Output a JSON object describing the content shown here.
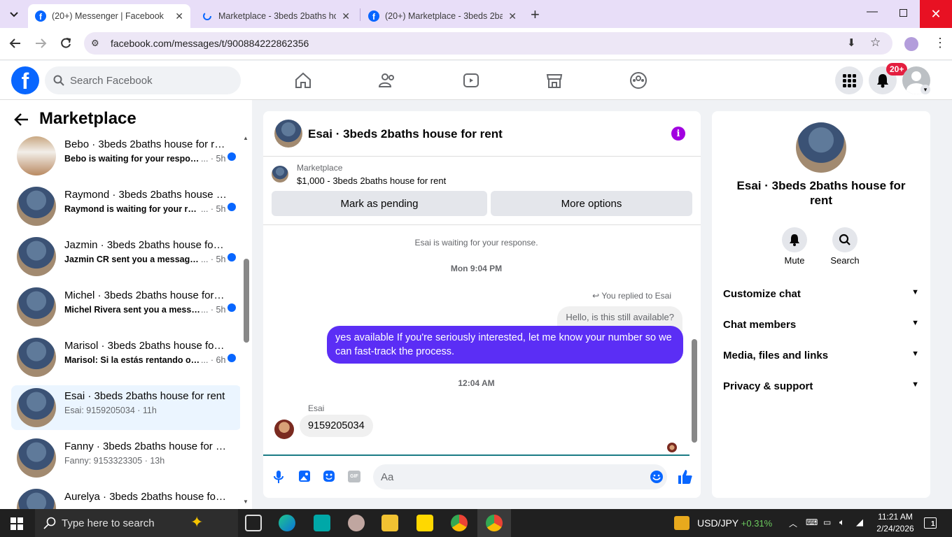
{
  "browser": {
    "tabs": [
      {
        "label": "(20+) Messenger | Facebook",
        "active": true
      },
      {
        "label": "Marketplace - 3beds 2baths ho",
        "active": false
      },
      {
        "label": "(20+) Marketplace - 3beds 2bat",
        "active": false
      }
    ],
    "url": "facebook.com/messages/t/900884222862356"
  },
  "fb": {
    "search_placeholder": "Search Facebook",
    "notification_badge": "20+"
  },
  "sidebar": {
    "title": "Marketplace",
    "conversations": [
      {
        "name": "Bebo · 3beds 2baths house for rent",
        "preview": "Bebo is waiting for your response",
        "time": "5h",
        "unread": true
      },
      {
        "name": "Raymond · 3beds 2baths house for rent",
        "preview": "Raymond is waiting for your response",
        "time": "5h",
        "unread": true
      },
      {
        "name": "Jazmin · 3beds 2baths house for rent",
        "preview": "Jazmin CR sent you a message about",
        "time": "5h",
        "unread": true
      },
      {
        "name": "Michel · 3beds 2baths house for rent",
        "preview": "Michel Rivera sent you a message",
        "time": "5h",
        "unread": true
      },
      {
        "name": "Marisol · 3beds 2baths house for rent",
        "preview": "Marisol: Si la estás rentando o es",
        "time": "6h",
        "unread": true
      },
      {
        "name": "Esai · 3beds 2baths house for rent",
        "preview": "Esai: 9159205034",
        "time": "11h",
        "unread": false,
        "selected": true
      },
      {
        "name": "Fanny · 3beds 2baths house for rent",
        "preview": "Fanny: 9153323305",
        "time": "13h",
        "unread": false
      },
      {
        "name": "Aurelya · 3beds 2baths house for rent",
        "preview": "",
        "time": "",
        "unread": false
      }
    ]
  },
  "chat": {
    "title": "Esai · 3beds 2baths house for rent",
    "listing_source": "Marketplace",
    "listing_title": "$1,000 - 3beds 2baths house for rent",
    "mark_pending": "Mark as pending",
    "more_options": "More options",
    "waiting_note": "Esai is waiting for your response.",
    "ts1": "Mon 9:04 PM",
    "replied_to": "You replied to Esai",
    "quoted": "Hello, is this still available?",
    "outgoing": "yes available If you're seriously interested, let me know your number so we can fast-track the process.",
    "ts2": "12:04 AM",
    "sender": "Esai",
    "incoming": "9159205034",
    "composer_placeholder": "Aa"
  },
  "info": {
    "title": "Esai · 3beds 2baths house for rent",
    "mute": "Mute",
    "search": "Search",
    "rows": [
      "Customize chat",
      "Chat members",
      "Media, files and links",
      "Privacy & support"
    ]
  },
  "taskbar": {
    "search_placeholder": "Type here to search",
    "ticker": "USD/JPY",
    "ticker_change": "+0.31%",
    "time": "11:21 AM",
    "date": "2/24/2026",
    "notif_count": "1"
  },
  "colors": {
    "fb_blue": "#0866ff",
    "messenger_purple": "#5b2ef5",
    "ticker_green": "#6ccb5f"
  }
}
